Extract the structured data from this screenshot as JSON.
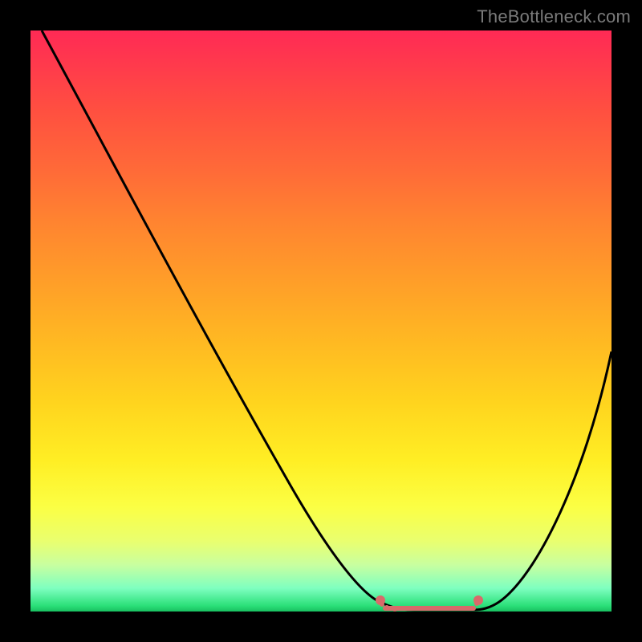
{
  "watermark": "TheBottleneck.com",
  "chart_data": {
    "type": "line",
    "title": "",
    "xlabel": "",
    "ylabel": "",
    "xlim": [
      0,
      100
    ],
    "ylim": [
      0,
      100
    ],
    "grid": false,
    "legend": false,
    "background_gradient": {
      "top": "#ff2a55",
      "mid1": "#ffba22",
      "mid2": "#fbff44",
      "bottom": "#18c060"
    },
    "series": [
      {
        "name": "bottleneck-curve",
        "color": "#000000",
        "x": [
          2,
          8,
          14,
          20,
          26,
          32,
          38,
          44,
          50,
          56,
          60,
          62,
          64,
          66,
          68,
          70,
          72,
          74,
          76,
          80,
          84,
          88,
          92,
          96,
          100
        ],
        "y": [
          100,
          91,
          82,
          73,
          64,
          55,
          46,
          37,
          28,
          19,
          12,
          8,
          5,
          3,
          2,
          1.5,
          1.2,
          1,
          1,
          2,
          5,
          12,
          22,
          33,
          45
        ]
      }
    ],
    "markers": [
      {
        "name": "flat-region-left",
        "x": 62,
        "y": 4,
        "color": "#e06a6a"
      },
      {
        "name": "flat-region-right",
        "x": 76,
        "y": 2,
        "color": "#e06a6a"
      }
    ]
  }
}
